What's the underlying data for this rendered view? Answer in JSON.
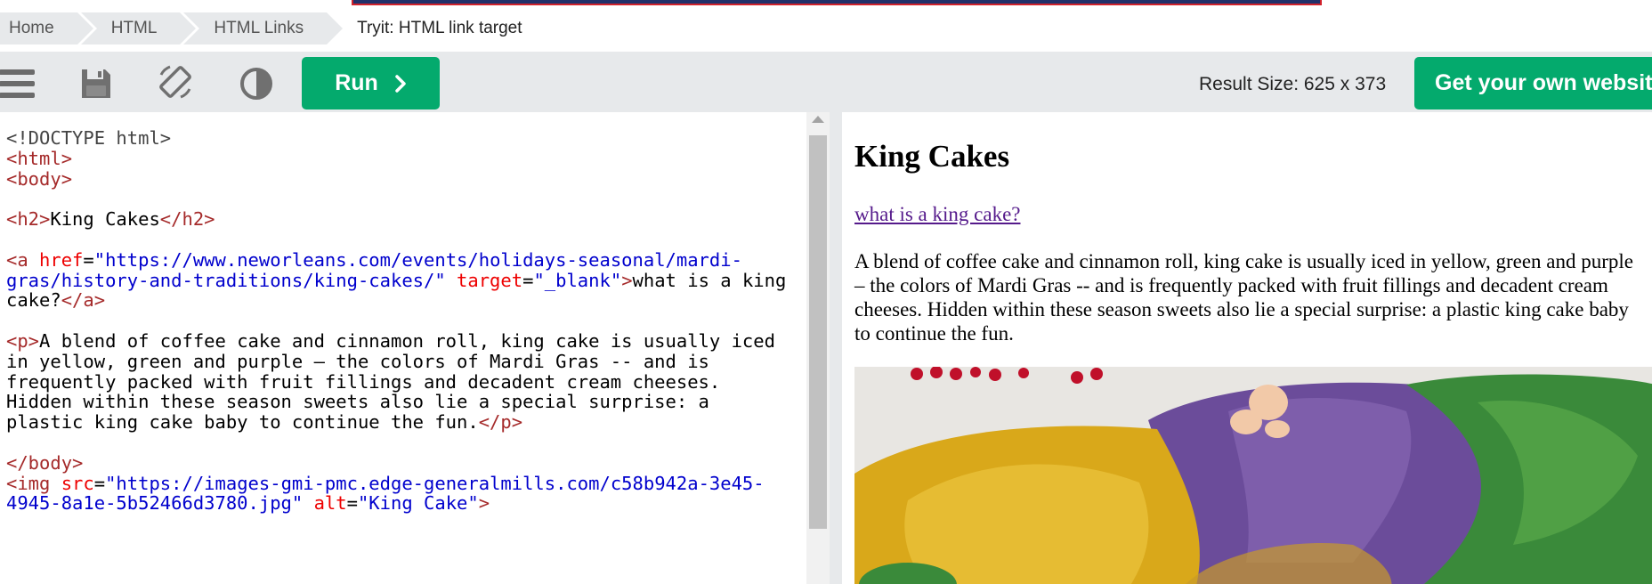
{
  "breadcrumb": [
    "Home",
    "HTML",
    "HTML Links",
    "Tryit: HTML link target"
  ],
  "toolbar": {
    "menu_icon": "hamburger-menu-icon",
    "save_icon": "save-icon",
    "rotate_icon": "rotate-screen-icon",
    "theme_icon": "contrast-icon",
    "run_label": "Run",
    "result_size": "Result Size: 625 x 373",
    "own_website_label": "Get your own website"
  },
  "code_lines": [
    [
      [
        "#444",
        "<!DOCTYPE html>"
      ]
    ],
    [
      [
        "#a52a2a",
        "<html>"
      ]
    ],
    [
      [
        "#a52a2a",
        "<body>"
      ]
    ],
    [],
    [
      [
        "#a52a2a",
        "<h2>"
      ],
      [
        "#000",
        "King Cakes"
      ],
      [
        "#a52a2a",
        "</h2>"
      ]
    ],
    [],
    [
      [
        "#a52a2a",
        "<a "
      ],
      [
        "#e00",
        "href"
      ],
      [
        "#000",
        "="
      ],
      [
        "#0000cd",
        "\"https://www.neworleans.com/events/holidays-seasonal/mardi-"
      ]
    ],
    [
      [
        "#0000cd",
        "gras/history-and-traditions/king-cakes/\" "
      ],
      [
        "#e00",
        "target"
      ],
      [
        "#000",
        "="
      ],
      [
        "#0000cd",
        "\"_blank\""
      ],
      [
        "#a52a2a",
        ">"
      ],
      [
        "#000",
        "what is a king"
      ]
    ],
    [
      [
        "#000",
        "cake?"
      ],
      [
        "#a52a2a",
        "</a>"
      ]
    ],
    [],
    [
      [
        "#a52a2a",
        "<p>"
      ],
      [
        "#000",
        "A blend of coffee cake and cinnamon roll, king cake is usually iced"
      ]
    ],
    [
      [
        "#000",
        "in yellow, green and purple – the colors of Mardi Gras -- and is"
      ]
    ],
    [
      [
        "#000",
        "frequently packed with fruit fillings and decadent cream cheeses."
      ]
    ],
    [
      [
        "#000",
        "Hidden within these season sweets also lie a special surprise: a"
      ]
    ],
    [
      [
        "#000",
        "plastic king cake baby to continue the fun."
      ],
      [
        "#a52a2a",
        "</p>"
      ]
    ],
    [],
    [
      [
        "#a52a2a",
        "</body>"
      ]
    ],
    [
      [
        "#a52a2a",
        "<img "
      ],
      [
        "#e00",
        "src"
      ],
      [
        "#000",
        "="
      ],
      [
        "#0000cd",
        "\"https://images-gmi-pmc.edge-generalmills.com/c58b942a-3e45-"
      ]
    ],
    [
      [
        "#0000cd",
        "4945-8a1e-5b52466d3780.jpg\" "
      ],
      [
        "#e00",
        "alt"
      ],
      [
        "#000",
        "="
      ],
      [
        "#0000cd",
        "\"King Cake\""
      ],
      [
        "#a52a2a",
        ">"
      ]
    ]
  ],
  "result": {
    "heading": "King Cakes",
    "link_text": "what is a king cake?",
    "paragraph": "A blend of coffee cake and cinnamon roll, king cake is usually iced in yellow, green and purple – the colors of Mardi Gras -- and is frequently packed with fruit fillings and decadent cream cheeses. Hidden within these season sweets also lie a special surprise: a plastic king cake baby to continue the fun."
  },
  "colors": {
    "accent_green": "#04aa6d",
    "toolbar_gray": "#e7e9eb",
    "visited_link": "#551a8b"
  }
}
